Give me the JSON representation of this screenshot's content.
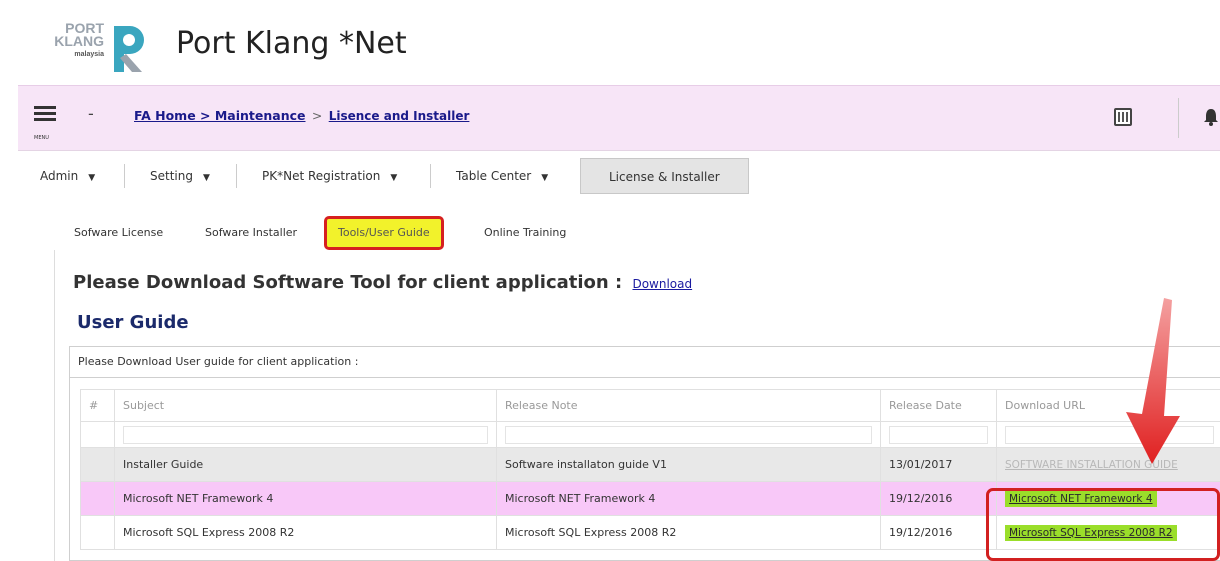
{
  "header": {
    "logo_line1": "PORT",
    "logo_line2": "KLANG",
    "logo_line3": "malaysia",
    "app_title": "Port Klang *Net"
  },
  "toolbar": {
    "menu_label": "MENU",
    "dot_menu": "-",
    "breadcrumb_home": "FA Home > Maintenance",
    "breadcrumb_sep": ">",
    "breadcrumb_current": "Lisence and Installer"
  },
  "tabs": [
    {
      "label": "Admin"
    },
    {
      "label": "Setting"
    },
    {
      "label": "PK*Net Registration"
    },
    {
      "label": "Table Center"
    },
    {
      "label": "License & Installer"
    }
  ],
  "subtabs": [
    {
      "label": "Sofware License"
    },
    {
      "label": "Sofware Installer"
    },
    {
      "label": "Tools/User Guide"
    },
    {
      "label": "Online Training"
    }
  ],
  "content": {
    "download_text": "Please Download Software Tool for client application :",
    "download_link": "Download",
    "guide_title": "User Guide",
    "table_caption": "Please Download User guide for client application :"
  },
  "table": {
    "headers": [
      "#",
      "Subject",
      "Release Note",
      "Release Date",
      "Download URL"
    ],
    "rows": [
      {
        "subject": "Installer Guide",
        "note": "Software installaton guide V1",
        "date": "13/01/2017",
        "url": "SOFTWARE INSTALLATION GUIDE"
      },
      {
        "subject": "Microsoft NET Framework 4",
        "note": "Microsoft NET Framework 4",
        "date": "19/12/2016",
        "url": "Microsoft NET Framework 4"
      },
      {
        "subject": "Microsoft SQL Express 2008 R2",
        "note": "Microsoft SQL Express 2008 R2",
        "date": "19/12/2016",
        "url": "Microsoft SQL Express 2008 R2"
      }
    ]
  },
  "colors": {
    "pink_bar": "#f7e5f7",
    "active_subtab": "#f2f22b",
    "highlight_red": "#d62020",
    "link_green": "#9ade2a",
    "row_pink": "#f8c8f8"
  }
}
